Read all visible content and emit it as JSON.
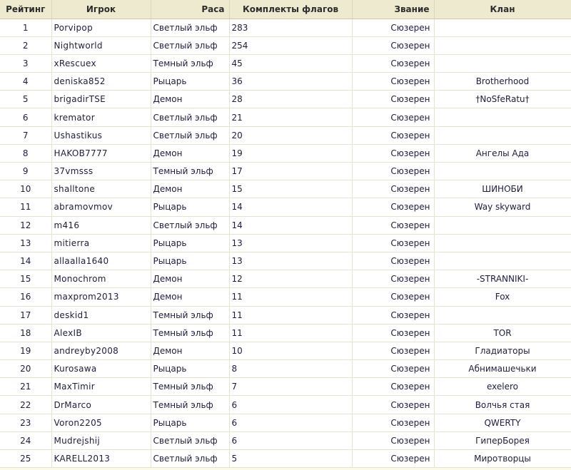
{
  "headers": {
    "rank": "Рейтинг",
    "player": "Игрок",
    "race": "Раса",
    "flags": "Комплекты флагов",
    "title": "Звание",
    "clan": "Клан"
  },
  "rows": [
    {
      "rank": "1",
      "player": "Porvipop",
      "race": "Светлый эльф",
      "flags": "283",
      "title": "Сюзерен",
      "clan": ""
    },
    {
      "rank": "2",
      "player": "Nightworld",
      "race": "Светлый эльф",
      "flags": "254",
      "title": "Сюзерен",
      "clan": ""
    },
    {
      "rank": "3",
      "player": "xRescuex",
      "race": "Темный эльф",
      "flags": "45",
      "title": "Сюзерен",
      "clan": ""
    },
    {
      "rank": "4",
      "player": "deniska852",
      "race": "Рыцарь",
      "flags": "36",
      "title": "Сюзерен",
      "clan": "Brotherhood"
    },
    {
      "rank": "5",
      "player": "brigadirTSE",
      "race": "Демон",
      "flags": "28",
      "title": "Сюзерен",
      "clan": "†NoSfeRatu†"
    },
    {
      "rank": "6",
      "player": "kremator",
      "race": "Светлый эльф",
      "flags": "21",
      "title": "Сюзерен",
      "clan": ""
    },
    {
      "rank": "7",
      "player": "Ushastikus",
      "race": "Светлый эльф",
      "flags": "20",
      "title": "Сюзерен",
      "clan": ""
    },
    {
      "rank": "8",
      "player": "HAKOB7777",
      "race": "Демон",
      "flags": "19",
      "title": "Сюзерен",
      "clan": "Ангелы Ада"
    },
    {
      "rank": "9",
      "player": "37vmsss",
      "race": "Темный эльф",
      "flags": "17",
      "title": "Сюзерен",
      "clan": ""
    },
    {
      "rank": "10",
      "player": "shalltone",
      "race": "Демон",
      "flags": "15",
      "title": "Сюзерен",
      "clan": "ШИНОБИ"
    },
    {
      "rank": "11",
      "player": "abramovmov",
      "race": "Рыцарь",
      "flags": "14",
      "title": "Сюзерен",
      "clan": "Way skyward"
    },
    {
      "rank": "12",
      "player": "m416",
      "race": "Светлый эльф",
      "flags": "14",
      "title": "Сюзерен",
      "clan": ""
    },
    {
      "rank": "13",
      "player": "mitierra",
      "race": "Рыцарь",
      "flags": "13",
      "title": "Сюзерен",
      "clan": ""
    },
    {
      "rank": "14",
      "player": "allaalla1640",
      "race": "Рыцарь",
      "flags": "13",
      "title": "Сюзерен",
      "clan": ""
    },
    {
      "rank": "15",
      "player": "Monochrom",
      "race": "Демон",
      "flags": "12",
      "title": "Сюзерен",
      "clan": "-STRANNIKI-"
    },
    {
      "rank": "16",
      "player": "maxprom2013",
      "race": "Демон",
      "flags": "11",
      "title": "Сюзерен",
      "clan": "Fox"
    },
    {
      "rank": "17",
      "player": "deskid1",
      "race": "Темный эльф",
      "flags": "11",
      "title": "Сюзерен",
      "clan": ""
    },
    {
      "rank": "18",
      "player": "AlexIB",
      "race": "Темный эльф",
      "flags": "11",
      "title": "Сюзерен",
      "clan": "TOR"
    },
    {
      "rank": "19",
      "player": "andreyby2008",
      "race": "Демон",
      "flags": "10",
      "title": "Сюзерен",
      "clan": "Гладиаторы"
    },
    {
      "rank": "20",
      "player": "Kurosawa",
      "race": "Рыцарь",
      "flags": "8",
      "title": "Сюзерен",
      "clan": "Абнимашечьки"
    },
    {
      "rank": "21",
      "player": "MaxTimir",
      "race": "Темный эльф",
      "flags": "7",
      "title": "Сюзерен",
      "clan": "exelero"
    },
    {
      "rank": "22",
      "player": "DrMarco",
      "race": "Темный эльф",
      "flags": "6",
      "title": "Сюзерен",
      "clan": "Волчья стая"
    },
    {
      "rank": "23",
      "player": "Voron2205",
      "race": "Рыцарь",
      "flags": "6",
      "title": "Сюзерен",
      "clan": "QWERTY"
    },
    {
      "rank": "24",
      "player": "Mudrejshij",
      "race": "Светлый эльф",
      "flags": "6",
      "title": "Сюзерен",
      "clan": "ГиперБорея"
    },
    {
      "rank": "25",
      "player": "KARELL2013",
      "race": "Светлый эльф",
      "flags": "5",
      "title": "Сюзерен",
      "clan": "Миротворцы"
    }
  ]
}
